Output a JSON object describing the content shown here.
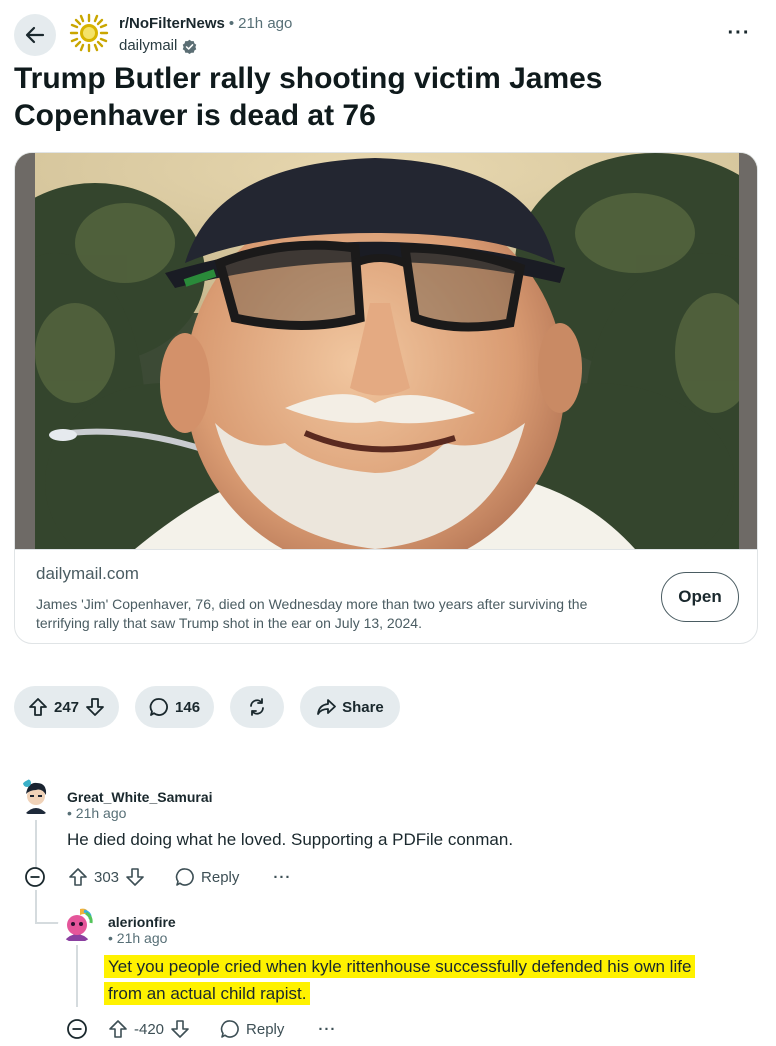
{
  "post": {
    "subreddit": "r/NoFilterNews",
    "time": "21h ago",
    "source": "dailymail",
    "title": "Trump Butler rally shooting victim James Copenhaver is dead at 76"
  },
  "link_card": {
    "domain": "dailymail.com",
    "description": "James 'Jim' Copenhaver, 76, died on Wednesday more than two years after surviving the terrifying rally that saw Trump shot in the ear on July 13, 2024.",
    "open_label": "Open"
  },
  "actions": {
    "votes": "247",
    "comments": "146",
    "share_label": "Share"
  },
  "comments": [
    {
      "author": "Great_White_Samurai",
      "time": "21h ago",
      "text": "He died doing what he loved. Supporting a PDFile conman.",
      "votes": "303",
      "reply_label": "Reply"
    },
    {
      "author": "alerionfire",
      "time": "21h ago",
      "text_line1": "Yet you people cried when kyle rittenhouse successfully defended his own life",
      "text_line2": "from an actual child rapist.",
      "votes": "-420",
      "reply_label": "Reply"
    }
  ],
  "colors": {
    "pill_bg": "#e5ebee",
    "highlight": "#fff200",
    "text": "#1a282d",
    "muted": "#576f76"
  },
  "icons": [
    "back-arrow-icon",
    "subreddit-sun-icon",
    "verified-badge-icon",
    "more-options-icon",
    "upvote-icon",
    "downvote-icon",
    "comment-icon",
    "crosspost-icon",
    "share-icon",
    "collapse-icon",
    "reply-icon"
  ]
}
